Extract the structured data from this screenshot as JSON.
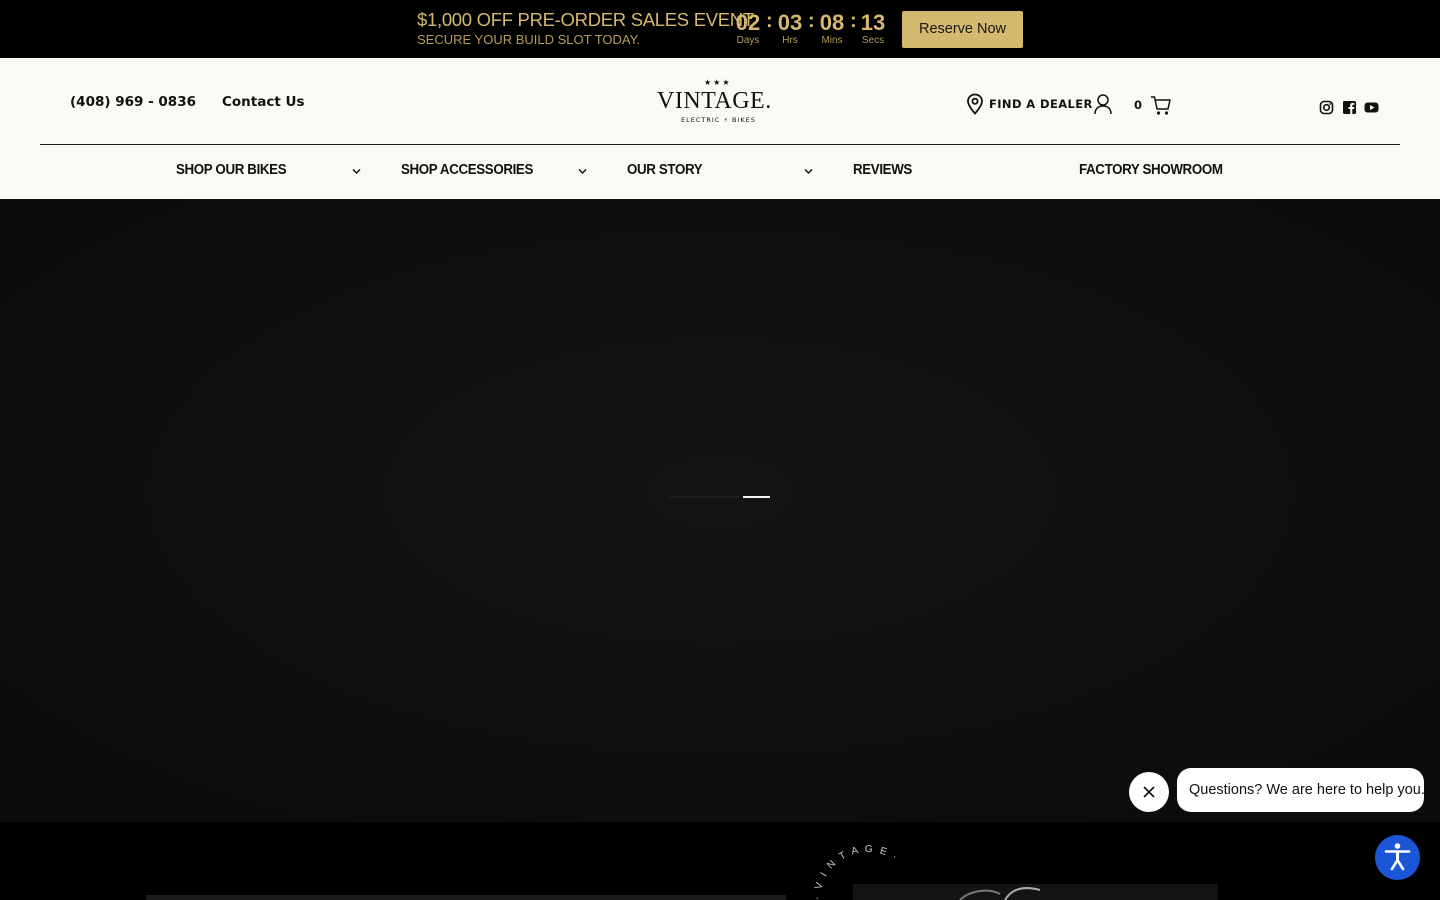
{
  "promo": {
    "title": "$1,000 OFF PRE-ORDER SALES EVENT",
    "subtitle": "SECURE YOUR BUILD SLOT TODAY.",
    "countdown": [
      {
        "value": "02",
        "label": "Days"
      },
      {
        "value": "03",
        "label": "Hrs"
      },
      {
        "value": "08",
        "label": "Mins"
      },
      {
        "value": "13",
        "label": "Secs"
      }
    ],
    "cta": "Reserve Now"
  },
  "header": {
    "phone": "(408) 969 - 0836",
    "contact": "Contact Us",
    "logo": {
      "word": "VINTAGE.",
      "sub": "ELECTRIC ⚡ BIKES",
      "stars": "★★★"
    },
    "dealer": "FIND A DEALER",
    "cart_count": "0",
    "icons": [
      "location-pin-icon",
      "account-icon",
      "cart-icon",
      "instagram-icon",
      "facebook-icon",
      "youtube-icon"
    ]
  },
  "nav": [
    {
      "label": "SHOP OUR BIKES",
      "dropdown": true
    },
    {
      "label": "SHOP ACCESSORIES",
      "dropdown": true
    },
    {
      "label": "OUR STORY",
      "dropdown": true
    },
    {
      "label": "REVIEWS",
      "dropdown": false
    },
    {
      "label": "FACTORY SHOWROOM",
      "dropdown": false
    }
  ],
  "hero": {
    "slides": 2,
    "active_slide": 2
  },
  "below": {
    "badge_text": "· V I N T A G E ·"
  },
  "chat": {
    "message": "Questions? We are here to help you."
  },
  "colors": {
    "gold": "#d5b76f",
    "button_gold": "#d4b86d",
    "header_bg": "#fbf9f3",
    "accessibility_blue": "#1a56d6"
  }
}
